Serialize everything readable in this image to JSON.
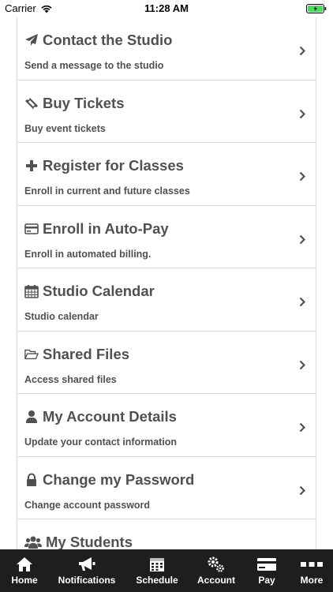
{
  "status_bar": {
    "carrier": "Carrier",
    "time": "11:28 AM"
  },
  "menu": {
    "items": [
      {
        "title": "Contact the Studio",
        "description": "Send a message to the studio",
        "icon": "paper-plane-icon"
      },
      {
        "title": "Buy Tickets",
        "description": "Buy event tickets",
        "icon": "ticket-icon"
      },
      {
        "title": "Register for Classes",
        "description": "Enroll in current and future classes",
        "icon": "plus-icon"
      },
      {
        "title": "Enroll in Auto-Pay",
        "description": "Enroll in automated billing.",
        "icon": "credit-card-icon"
      },
      {
        "title": "Studio Calendar",
        "description": "Studio calendar",
        "icon": "calendar-icon"
      },
      {
        "title": "Shared Files",
        "description": "Access shared files",
        "icon": "folder-open-icon"
      },
      {
        "title": "My Account Details",
        "description": "Update your contact information",
        "icon": "user-icon"
      },
      {
        "title": "Change my Password",
        "description": "Change account password",
        "icon": "lock-icon"
      },
      {
        "title": "My Students",
        "description": "",
        "icon": "users-icon"
      }
    ]
  },
  "tabbar": {
    "tabs": [
      {
        "label": "Home",
        "icon": "home-icon"
      },
      {
        "label": "Notifications",
        "icon": "megaphone-icon"
      },
      {
        "label": "Schedule",
        "icon": "calendar-grid-icon"
      },
      {
        "label": "Account",
        "icon": "gears-icon"
      },
      {
        "label": "Pay",
        "icon": "credit-card-icon"
      },
      {
        "label": "More",
        "icon": "more-icon"
      }
    ]
  },
  "colors": {
    "text": "#505050",
    "tabbar_bg": "#1e1e1e",
    "battery": "#4cd964",
    "divider": "#dcdcdc"
  }
}
